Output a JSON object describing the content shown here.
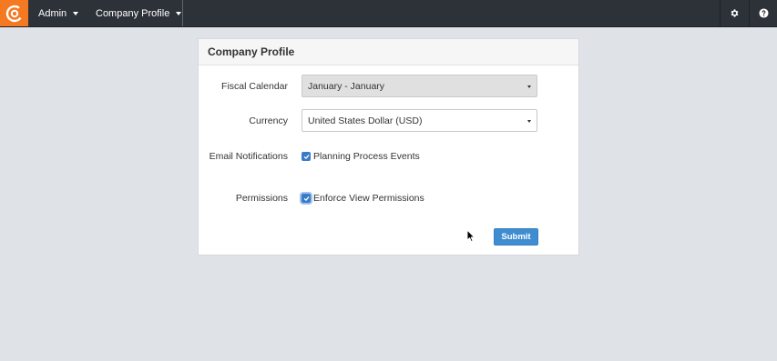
{
  "nav": {
    "logo_icon": "brand-logo-icon",
    "admin_label": "Admin",
    "company_profile_label": "Company Profile",
    "settings_icon": "gear-icon",
    "help_icon": "question-icon"
  },
  "colors": {
    "topbar": "#2d3239",
    "brand": "#f47920",
    "accent": "#3f8dd0",
    "background": "#dfe2e6"
  },
  "panel": {
    "title": "Company Profile",
    "fiscal_calendar": {
      "label": "Fiscal Calendar",
      "value": "January - January"
    },
    "currency": {
      "label": "Currency",
      "value": "United States Dollar (USD)"
    },
    "email_notifications": {
      "label": "Email Notifications",
      "option": "Planning Process Events",
      "checked": true
    },
    "permissions": {
      "label": "Permissions",
      "option": "Enforce View Permissions",
      "checked": true
    },
    "submit_label": "Submit"
  }
}
